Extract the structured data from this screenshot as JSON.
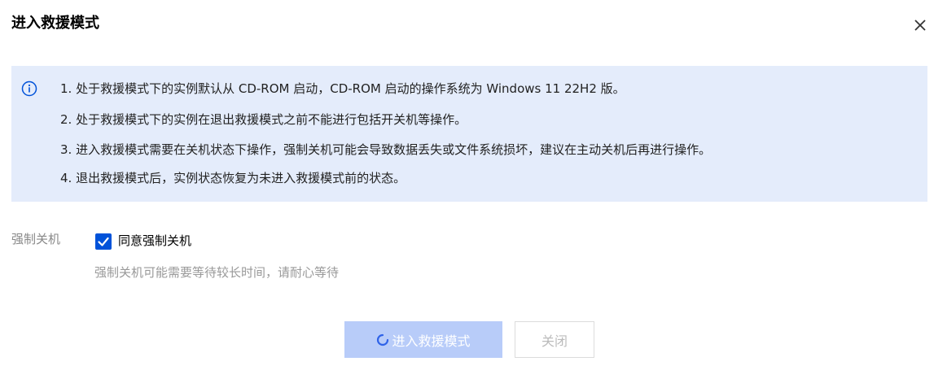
{
  "dialog": {
    "title": "进入救援模式",
    "close_icon": "close-icon"
  },
  "notice": {
    "icon": "info-icon",
    "lines": [
      "1. 处于救援模式下的实例默认从 CD-ROM 启动，CD-ROM 启动的操作系统为 Windows 11 22H2 版。",
      "2. 处于救援模式下的实例在退出救援模式之前不能进行包括开关机等操作。",
      "3. 进入救援模式需要在关机状态下操作，强制关机可能会导致数据丢失或文件系统损坏，建议在主动关机后再进行操作。",
      "4. 退出救援模式后，实例状态恢复为未进入救援模式前的状态。"
    ]
  },
  "form": {
    "force_shutdown_label": "强制关机",
    "checkbox_label": "同意强制关机",
    "checkbox_checked": true,
    "help_text": "强制关机可能需要等待较长时间，请耐心等待"
  },
  "footer": {
    "confirm_label": "进入救援模式",
    "confirm_loading": true,
    "close_label": "关闭"
  },
  "colors": {
    "accent": "#0052d9",
    "notice_bg": "#e4ecfb",
    "primary_disabled": "#b8ccf9"
  }
}
